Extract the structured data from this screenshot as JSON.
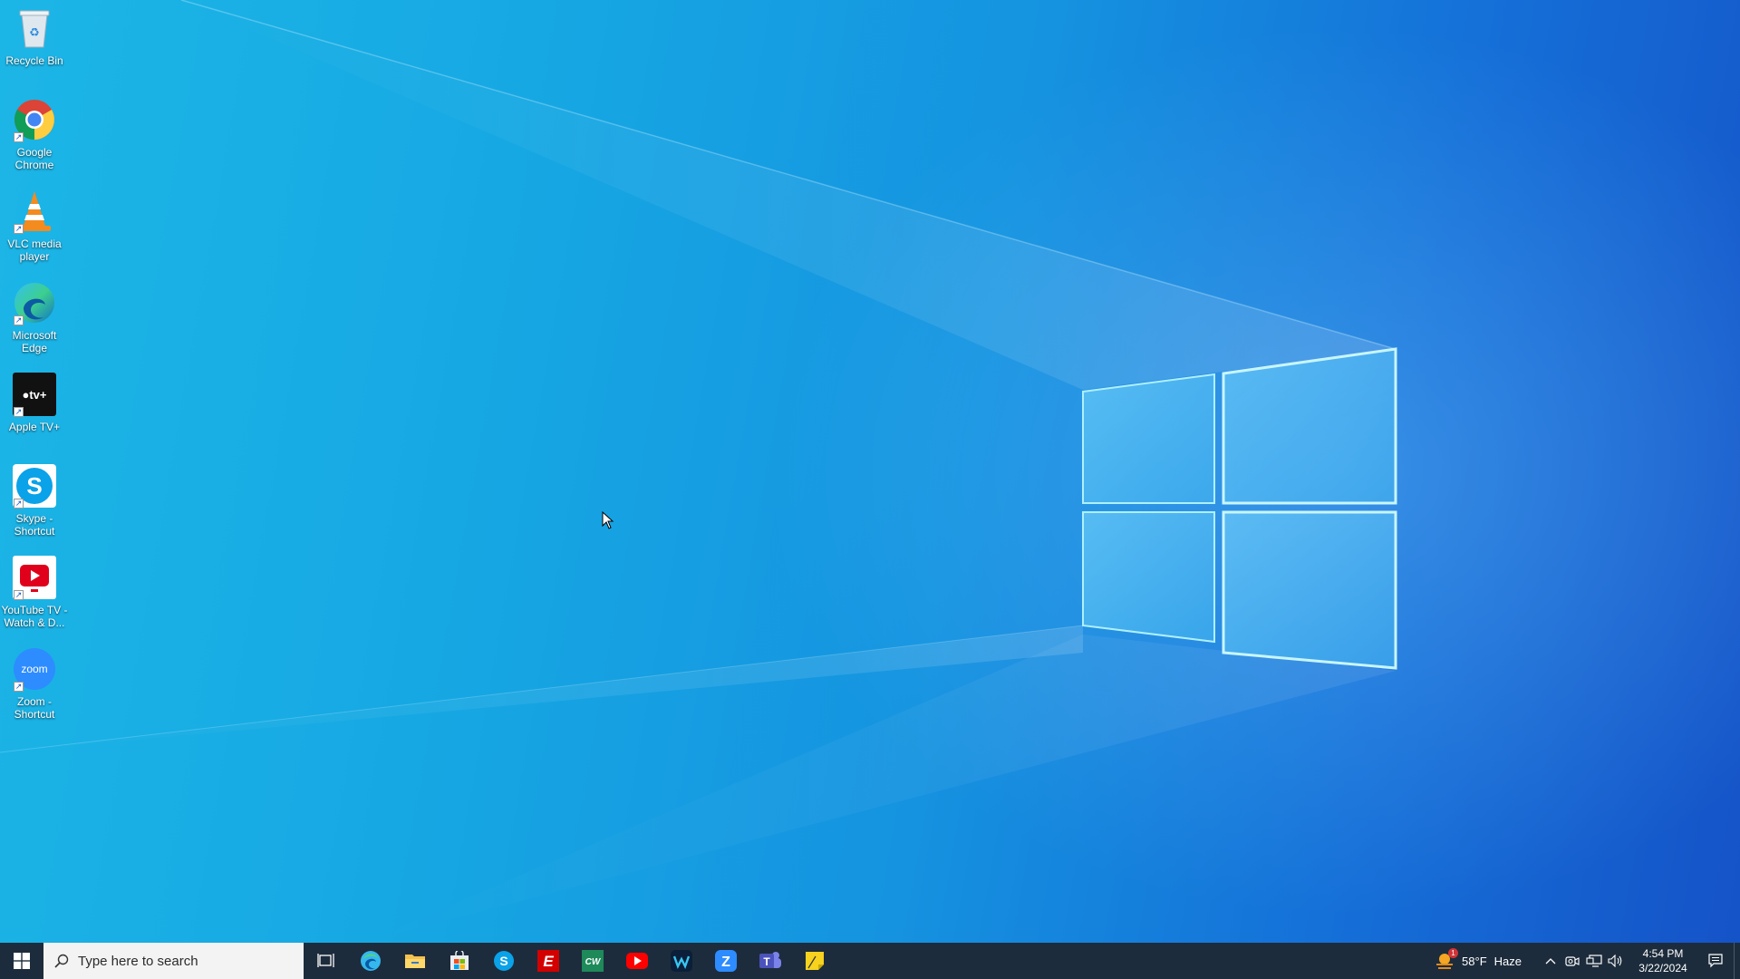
{
  "desktop_icons": [
    {
      "id": "recycle-bin",
      "label": "Recycle Bin"
    },
    {
      "id": "google-chrome",
      "label": "Google Chrome"
    },
    {
      "id": "vlc-media-player",
      "label": "VLC media player"
    },
    {
      "id": "microsoft-edge",
      "label": "Microsoft Edge"
    },
    {
      "id": "apple-tv",
      "label": "Apple TV+"
    },
    {
      "id": "skype-shortcut",
      "label": "Skype - Shortcut"
    },
    {
      "id": "youtube-tv",
      "label": "YouTube TV - Watch & D..."
    },
    {
      "id": "zoom-shortcut",
      "label": "Zoom - Shortcut"
    }
  ],
  "taskbar": {
    "search_placeholder": "Type here to search",
    "pinned_apps": [
      "task-view-icon",
      "edge-icon",
      "file-explorer-icon",
      "microsoft-store-icon",
      "skype-icon",
      "espn-icon",
      "cw-icon",
      "youtube-icon",
      "webex-icon",
      "zoom-icon",
      "teams-icon",
      "sticky-notes-icon"
    ],
    "weather": {
      "temperature": "58°F",
      "condition": "Haze",
      "badge": "1"
    },
    "clock": {
      "time": "4:54 PM",
      "date": "3/22/2024"
    }
  },
  "colors": {
    "taskbar_bg": "#1d2c3c",
    "desktop_left": "#1cb6e6",
    "desktop_right": "#1553c8"
  }
}
